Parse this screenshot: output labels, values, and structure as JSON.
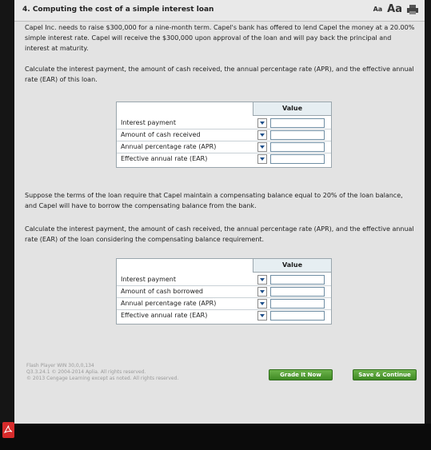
{
  "header": {
    "question_title": "4. Computing the cost of a simple interest loan",
    "font_small": "Aa",
    "font_large": "Aa"
  },
  "intro": "Capel Inc. needs to raise $300,000 for a nine-month term. Capel's bank has offered to lend Capel the money at a 20.00% simple interest rate. Capel will receive the $300,000 upon approval of the loan and will pay back the principal and interest at maturity.",
  "instruction1": "Calculate the interest payment, the amount of cash received, the annual percentage rate (APR), and the effective annual rate (EAR) of this loan.",
  "table1": {
    "value_header": "Value",
    "rows": [
      "Interest payment",
      "Amount of cash received",
      "Annual percentage rate (APR)",
      "Effective annual rate (EAR)"
    ]
  },
  "scenario2": "Suppose the terms of the loan require that Capel maintain a compensating balance equal to 20% of the loan balance, and Capel will have to borrow the compensating balance from the bank.",
  "instruction2": "Calculate the interest payment, the amount of cash received, the annual percentage rate (APR), and the effective annual rate (EAR) of the loan considering the compensating balance requirement.",
  "table2": {
    "value_header": "Value",
    "rows": [
      "Interest payment",
      "Amount of cash borrowed",
      "Annual percentage rate (APR)",
      "Effective annual rate (EAR)"
    ]
  },
  "footer": {
    "line1": "Flash Player WIN 30,0,0,134",
    "line2": "Q3.3.24.1 © 2004-2014 Aplia. All rights reserved.",
    "line3": "© 2013 Cengage Learning except as noted. All rights reserved."
  },
  "buttons": {
    "grade": "Grade It Now",
    "save": "Save & Continue"
  },
  "icons": {
    "print": "printer-icon",
    "taskbar_app": "pdf-reader-icon"
  }
}
